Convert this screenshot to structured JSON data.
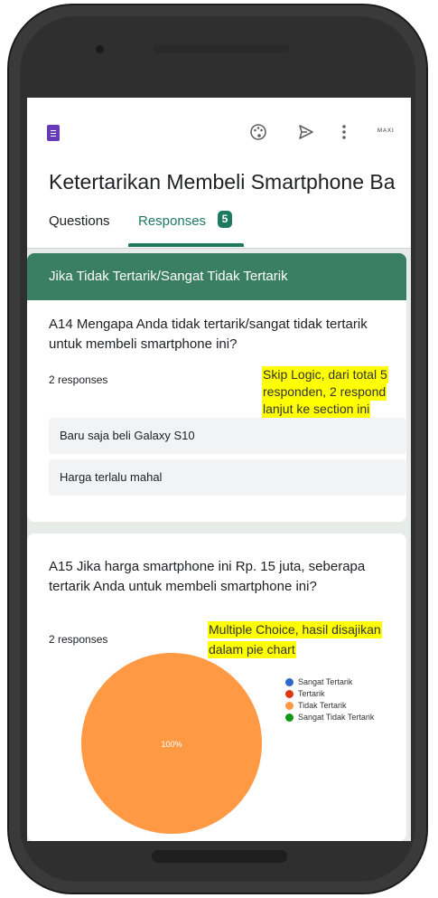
{
  "colors": {
    "accent": "#1e7a5e",
    "section_header": "#3a7f63",
    "form_icon": "#673ab7",
    "highlight": "#ffff00"
  },
  "app": {
    "brand_text": "MAXI",
    "icons": [
      "palette-icon",
      "send-icon",
      "more-vert-icon"
    ],
    "title": "Ketertarikan Membeli Smartphone Ba",
    "tabs": [
      {
        "label": "Questions",
        "active": false
      },
      {
        "label": "Responses",
        "active": true,
        "badge": "5"
      }
    ]
  },
  "section": {
    "header": "Jika Tidak Tertarik/Sangat Tidak Tertarik",
    "question": "A14 Mengapa Anda tidak tertarik/sangat tidak tertarik untuk membeli smartphone ini?",
    "response_count": "2 responses",
    "answers": [
      "Baru saja beli Galaxy S10",
      "Harga terlalu mahal"
    ]
  },
  "question2": {
    "title": "A15 Jika harga smartphone ini Rp. 15 juta, seberapa tertarik Anda untuk membeli smartphone ini?",
    "response_count": "2 responses"
  },
  "annotations": {
    "skip_logic_lines": [
      "Skip Logic, dari total 5",
      "responden,  2 respond",
      "lanjut ke section ini"
    ],
    "multiple_choice_lines": [
      "Multiple Choice, hasil disajikan",
      "dalam pie chart"
    ]
  },
  "chart_data": {
    "type": "pie",
    "categories": [
      "Sangat Tertarik",
      "Tertarik",
      "Tidak Tertarik",
      "Sangat Tidak Tertarik"
    ],
    "values": [
      0,
      0,
      100,
      0
    ],
    "colors": [
      "#3366cc",
      "#dc3912",
      "#ff9944",
      "#109618"
    ],
    "slice_label": "100%",
    "legend_position": "right"
  }
}
